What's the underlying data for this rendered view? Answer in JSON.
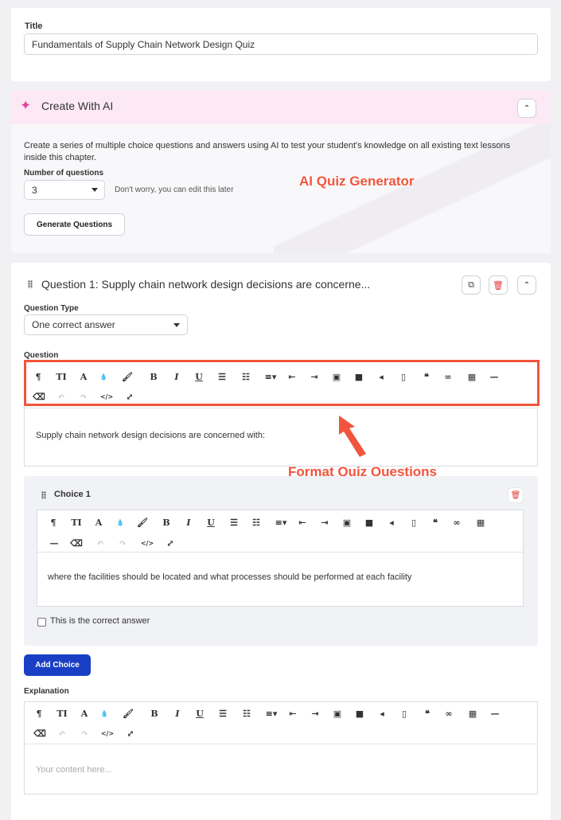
{
  "title_section": {
    "label": "Title",
    "value": "Fundamentals of Supply Chain Network Design Quiz"
  },
  "ai_section": {
    "heading": "Create With AI",
    "description": "Create a series of multiple choice questions and answers using AI to test your student's knowledge on all existing text lessons inside this chapter.",
    "num_questions_label": "Number of questions",
    "num_questions_value": "3",
    "hint": "Don't worry, you can edit this later",
    "generate_button": "Generate Questions",
    "annotation": "AI Quiz Generator"
  },
  "question": {
    "heading": "Question 1: Supply chain network design decisions are concerne...",
    "type_label": "Question Type",
    "type_value": "One correct answer",
    "question_label": "Question",
    "question_text": "Supply chain network design decisions are concerned with:",
    "annotation": "Format Quiz Questions"
  },
  "choice": {
    "heading": "Choice 1",
    "text": "where the facilities should be located and what processes should be performed at each facility",
    "correct_label": "This is the correct answer"
  },
  "add_choice_button": "Add Choice",
  "explanation": {
    "label": "Explanation",
    "placeholder": "Your content here..."
  },
  "toolbar": {
    "paragraph": "¶",
    "fontsize": "TI",
    "fontcolor": "A",
    "drop": "●",
    "bold": "B",
    "italic": "I",
    "underline": "U",
    "quote": "❝",
    "code": "</>"
  },
  "colors": {
    "primary": "#1a3fc4",
    "danger": "#e23b3b",
    "annotation": "#f2543d",
    "ai_header_bg": "#fce9f5"
  }
}
